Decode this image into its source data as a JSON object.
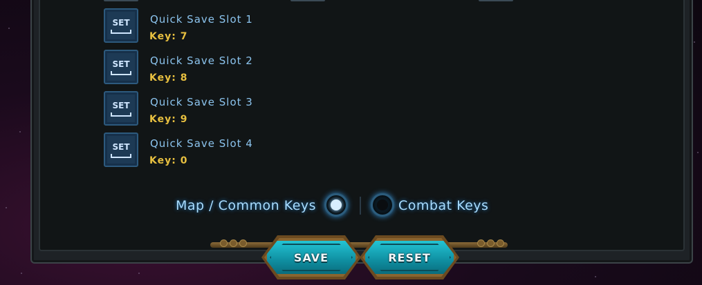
{
  "quick_save_slots": [
    {
      "set_label": "SET",
      "name": "Quick Save Slot 1",
      "key": "Key: 7"
    },
    {
      "set_label": "SET",
      "name": "Quick Save Slot 2",
      "key": "Key: 8"
    },
    {
      "set_label": "SET",
      "name": "Quick Save Slot 3",
      "key": "Key: 9"
    },
    {
      "set_label": "SET",
      "name": "Quick Save Slot 4",
      "key": "Key: 0"
    }
  ],
  "key_mode": {
    "options": [
      {
        "label": "Map / Common Keys",
        "selected": true
      },
      {
        "label": "Combat Keys",
        "selected": false
      }
    ]
  },
  "actions": {
    "save_label": "SAVE",
    "reset_label": "RESET"
  },
  "colors": {
    "slot_name": "#8cc4ee",
    "slot_key": "#e8c040",
    "button_teal": "#1aaebe",
    "button_border": "#8a6530"
  }
}
